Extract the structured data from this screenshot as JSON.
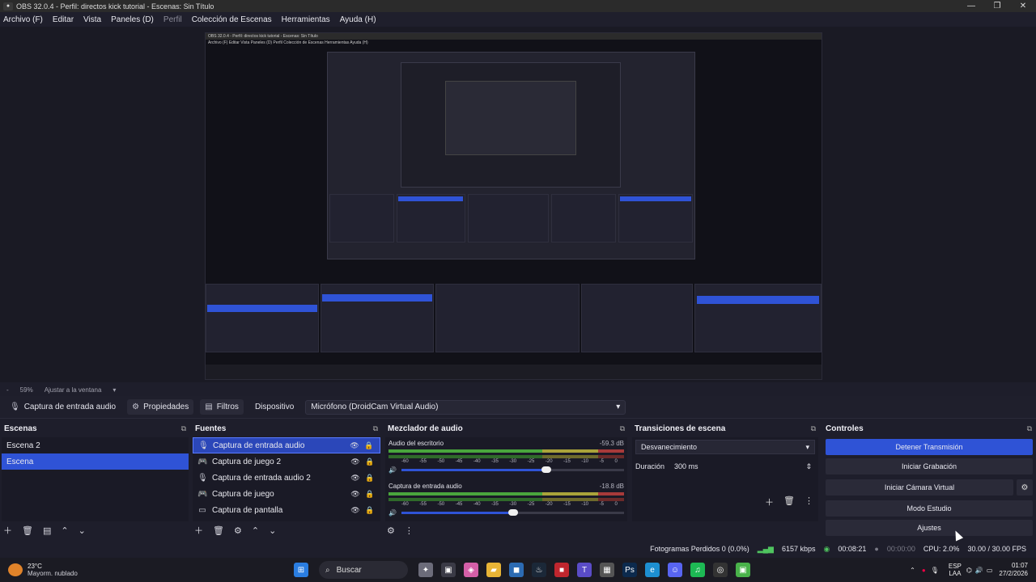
{
  "window": {
    "title": "OBS 32.0.4 - Perfil: directos kick tutorial - Escenas: Sin Título",
    "controls": [
      "—",
      "❐",
      "✕"
    ]
  },
  "menu": {
    "items": [
      "Archivo (F)",
      "Editar",
      "Vista",
      "Paneles (D)",
      "Perfil",
      "Colección de Escenas",
      "Herramientas",
      "Ayuda (H)"
    ]
  },
  "preview": {
    "inner_title": "OBS 32.0.4 - Perfil: directos kick tutorial - Escenas: Sin Título",
    "inner_menu": "Archivo (F)   Editar   Vista   Paneles (D)   Perfil   Colección de Escenas   Herramientas   Ayuda (H)"
  },
  "zoom": {
    "dash": "-",
    "value": "59%",
    "fit": "Ajustar a la ventana",
    "arrow": "▾"
  },
  "source_bar": {
    "source_name": "Captura de entrada audio",
    "properties": "Propiedades",
    "filters": "Filtros",
    "device_label": "Dispositivo",
    "device_value": "Micrófono (DroidCam Virtual Audio)"
  },
  "scenes": {
    "title": "Escenas",
    "items": [
      "Escena 2",
      "Escena"
    ],
    "selected": "Escena"
  },
  "sources": {
    "title": "Fuentes",
    "items": [
      {
        "label": "Captura de entrada audio",
        "icon": "mic-icon"
      },
      {
        "label": "Captura de juego 2",
        "icon": "gamepad-icon"
      },
      {
        "label": "Captura de entrada audio 2",
        "icon": "mic-icon"
      },
      {
        "label": "Captura de juego",
        "icon": "gamepad-icon"
      },
      {
        "label": "Captura de pantalla",
        "icon": "monitor-icon"
      }
    ]
  },
  "mixer": {
    "title": "Mezclador de audio",
    "channels": [
      {
        "name": "Audio del escritorio",
        "db": "-59.3 dB",
        "level": 0.65
      },
      {
        "name": "Captura de entrada audio",
        "db": "-18.8 dB",
        "level": 0.5
      }
    ],
    "ticks": [
      "-60",
      "-55",
      "-50",
      "-45",
      "-40",
      "-35",
      "-30",
      "-25",
      "-20",
      "-15",
      "-10",
      "-5",
      "0"
    ]
  },
  "transitions": {
    "title": "Transiciones de escena",
    "selected": "Desvanecimiento",
    "duration_label": "Duración",
    "duration_value": "300 ms"
  },
  "controls": {
    "title": "Controles",
    "stop_stream": "Detener Transmisión",
    "start_record": "Iniciar Grabación",
    "start_vcam": "Iniciar Cámara Virtual",
    "studio_mode": "Modo Estudio",
    "settings": "Ajustes"
  },
  "status": {
    "dropped": "Fotogramas Perdidos 0 (0.0%)",
    "bitrate": "6157 kbps",
    "stream_time": "00:08:21",
    "rec_time": "00:00:00",
    "cpu": "CPU: 2.0%",
    "fps": "30.00 / 30.00 FPS"
  },
  "taskbar": {
    "temp": "23°C",
    "weather": "Mayorm. nublado",
    "search": "Buscar",
    "lang_top": "ESP",
    "lang_bottom": "LAA",
    "time": "01:07",
    "date": "27/2/2026"
  },
  "colors": {
    "accent": "#2f53d6",
    "meter_green": "#49a63d",
    "meter_yellow": "#aaa33a",
    "meter_red": "#a83a3a"
  }
}
